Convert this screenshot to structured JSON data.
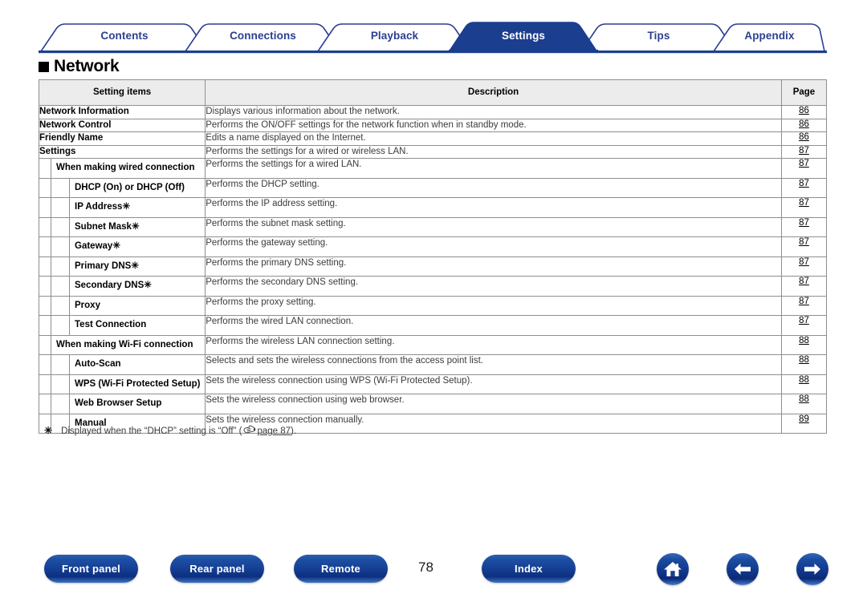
{
  "tabs": [
    {
      "label": "Contents",
      "active": false
    },
    {
      "label": "Connections",
      "active": false
    },
    {
      "label": "Playback",
      "active": false
    },
    {
      "label": "Settings",
      "active": true
    },
    {
      "label": "Tips",
      "active": false
    },
    {
      "label": "Appendix",
      "active": false
    }
  ],
  "heading": {
    "title": "Network"
  },
  "table": {
    "headers": {
      "item": "Setting items",
      "description": "Description",
      "page": "Page"
    },
    "rows": [
      {
        "level": 0,
        "item": "Network Information",
        "description": "Displays various information about the network.",
        "page": "86"
      },
      {
        "level": 0,
        "item": "Network Control",
        "description": "Performs the ON/OFF settings for the network function when in standby mode.",
        "page": "86"
      },
      {
        "level": 0,
        "item": "Friendly Name",
        "description": "Edits a name displayed on the Internet.",
        "page": "86"
      },
      {
        "level": 0,
        "item": "Settings",
        "description": "Performs the settings for a wired or wireless LAN.",
        "page": "87"
      },
      {
        "level": 1,
        "item": "When making wired connection",
        "description": "Performs the settings for a wired LAN.",
        "page": "87"
      },
      {
        "level": 2,
        "item": "DHCP (On) or DHCP (Off)",
        "description": "Performs the DHCP setting.",
        "page": "87"
      },
      {
        "level": 2,
        "item": "IP Address✳",
        "description": "Performs the IP address setting.",
        "page": "87"
      },
      {
        "level": 2,
        "item": "Subnet Mask✳",
        "description": "Performs the subnet mask setting.",
        "page": "87"
      },
      {
        "level": 2,
        "item": "Gateway✳",
        "description": "Performs the gateway setting.",
        "page": "87"
      },
      {
        "level": 2,
        "item": "Primary DNS✳",
        "description": "Performs the primary DNS setting.",
        "page": "87"
      },
      {
        "level": 2,
        "item": "Secondary DNS✳",
        "description": "Performs the secondary DNS setting.",
        "page": "87"
      },
      {
        "level": 2,
        "item": "Proxy",
        "description": "Performs the proxy setting.",
        "page": "87"
      },
      {
        "level": 2,
        "item": "Test Connection",
        "description": "Performs the wired LAN connection.",
        "page": "87"
      },
      {
        "level": 1,
        "item": "When making Wi-Fi connection",
        "description": "Performs the wireless LAN connection setting.",
        "page": "88"
      },
      {
        "level": 2,
        "item": "Auto-Scan",
        "description": "Selects and sets the wireless connections from the access point list.",
        "page": "88"
      },
      {
        "level": 2,
        "item": "WPS (Wi-Fi Protected Setup)",
        "description": "Sets the wireless connection using WPS (Wi-Fi Protected Setup).",
        "page": "88",
        "justify": true
      },
      {
        "level": 2,
        "item": "Web Browser Setup",
        "description": "Sets the wireless connection using web browser.",
        "page": "88"
      },
      {
        "level": 2,
        "item": "Manual",
        "description": "Sets the wireless connection manually.",
        "page": "89"
      }
    ]
  },
  "footnote": {
    "mark": "✳",
    "text_before": "Displayed when the “DHCP” setting is “Off” (",
    "link": "page 87",
    "text_after": ").",
    "icon": "pointing-hand-icon"
  },
  "footer": {
    "front_panel": "Front panel",
    "rear_panel": "Rear panel",
    "remote": "Remote",
    "index": "Index",
    "page_number": "78",
    "nav_icons": [
      "home-icon",
      "arrow-left-icon",
      "arrow-right-icon"
    ]
  },
  "colors": {
    "brand_blue": "#1b3e8f",
    "tab_text": "#2c3f91",
    "header_bg": "#ececec",
    "border": "#8e8e8e"
  }
}
